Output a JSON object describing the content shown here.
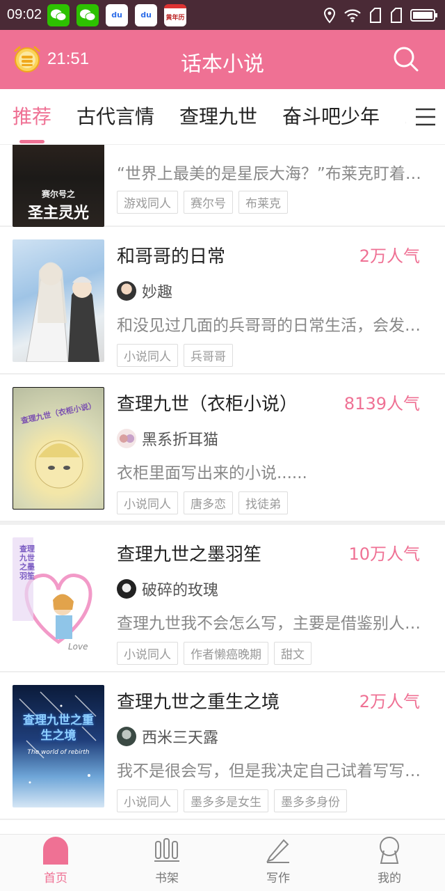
{
  "status_bar": {
    "time": "09:02",
    "apps": [
      "wechat-icon",
      "wechat-icon",
      "baidu-icon",
      "baidu-icon",
      "calendar-icon"
    ],
    "calendar_label": "黄年历",
    "baidu_label": "du"
  },
  "header": {
    "alarm_time": "21:51",
    "title": "话本小说",
    "accent_color": "#ef7194"
  },
  "tabs": {
    "items": [
      "推荐",
      "古代言情",
      "查理九世",
      "奋斗吧少年",
      "剧"
    ],
    "active_index": 0
  },
  "list": {
    "partial_item": {
      "cover_text": "圣主灵光",
      "cover_subtitle": "赛尔号之",
      "description": "“世界上最美的是星辰大海？”布莱克盯着那遍布星辰的窗户说...",
      "tags": [
        "游戏同人",
        "赛尔号",
        "布莱克"
      ]
    },
    "items": [
      {
        "title": "和哥哥的日常",
        "popularity": "2万人气",
        "author": "妙趣",
        "description": "和没见过几面的兵哥哥的日常生活，会发生什么有趣的故事呢",
        "tags": [
          "小说同人",
          "兵哥哥"
        ]
      },
      {
        "title": "查理九世（衣柜小说）",
        "popularity": "8139人气",
        "author": "黑系折耳猫",
        "description": "衣柜里面写出来的小说......",
        "tags": [
          "小说同人",
          "唐多恋",
          "找徒弟"
        ],
        "cover_text": "查理九世（衣柜小说）"
      },
      {
        "title": "查理九世之墨羽笙",
        "popularity": "10万人气",
        "author": "破碎的玫瑰",
        "description": "查理九世我不会怎么写，主要是借鉴别人的写法",
        "tags": [
          "小说同人",
          "作者懒癌晚期",
          "甜文"
        ],
        "cover_text": "查理九世之墨羽笙",
        "cover_love": "Love"
      },
      {
        "title": "查理九世之重生之境",
        "popularity": "2万人气",
        "author": "西米三天露",
        "description": "我不是很会写，但是我决定自己试着写写看吧",
        "tags": [
          "小说同人",
          "墨多多是女生",
          "墨多多身份"
        ],
        "cover_text": "查理九世之重生之境",
        "cover_subtitle": "The world of rebirth"
      }
    ]
  },
  "bottom_nav": {
    "items": [
      "首页",
      "书架",
      "写作",
      "我的"
    ],
    "active_index": 0
  }
}
